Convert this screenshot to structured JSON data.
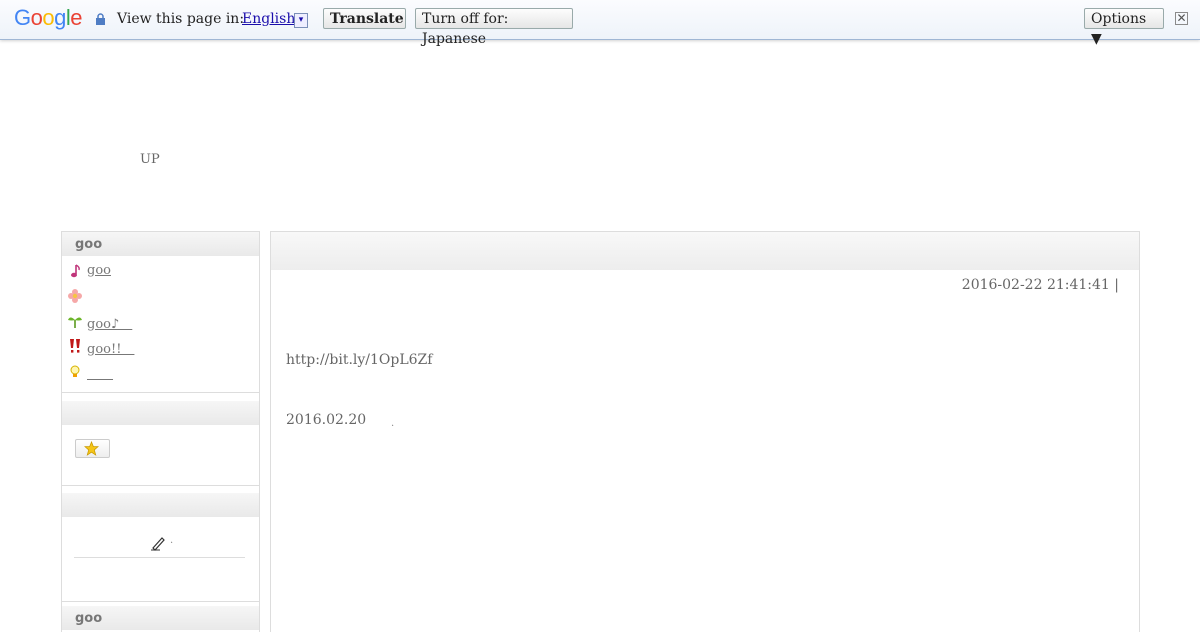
{
  "translate_bar": {
    "logo": [
      "G",
      "o",
      "o",
      "g",
      "l",
      "e"
    ],
    "logo_colors": [
      "#4285f4",
      "#ea4335",
      "#fbbc05",
      "#4285f4",
      "#34a853",
      "#ea4335"
    ],
    "view_label": "View this page in:",
    "language": "English",
    "dropdown_glyph": "▾",
    "translate_button": "Translate",
    "turn_off_button": "Turn off for: Japanese",
    "options_button": "Options ▼",
    "close_glyph": "✕"
  },
  "header": {
    "up_text": "UP"
  },
  "sidebar": {
    "section1_title": "goo",
    "items": [
      {
        "icon": "music-note-icon",
        "label": "goo"
      },
      {
        "icon": "flower-icon",
        "label": ""
      },
      {
        "icon": "sprout-icon",
        "label": "goo♪　"
      },
      {
        "icon": "double-exclamation-icon",
        "label": "goo!!　"
      },
      {
        "icon": "bulb-icon",
        "label": "　　"
      }
    ],
    "section2_title": "",
    "star_button_icon": "star-icon",
    "section3_title": "",
    "pen_dot": ".",
    "section4_title": "goo"
  },
  "article": {
    "date": "2016-02-22 21:41:41 |",
    "link": "http://bit.ly/1OpL6Zf",
    "line2": "2016.02.20",
    "dot": "."
  }
}
